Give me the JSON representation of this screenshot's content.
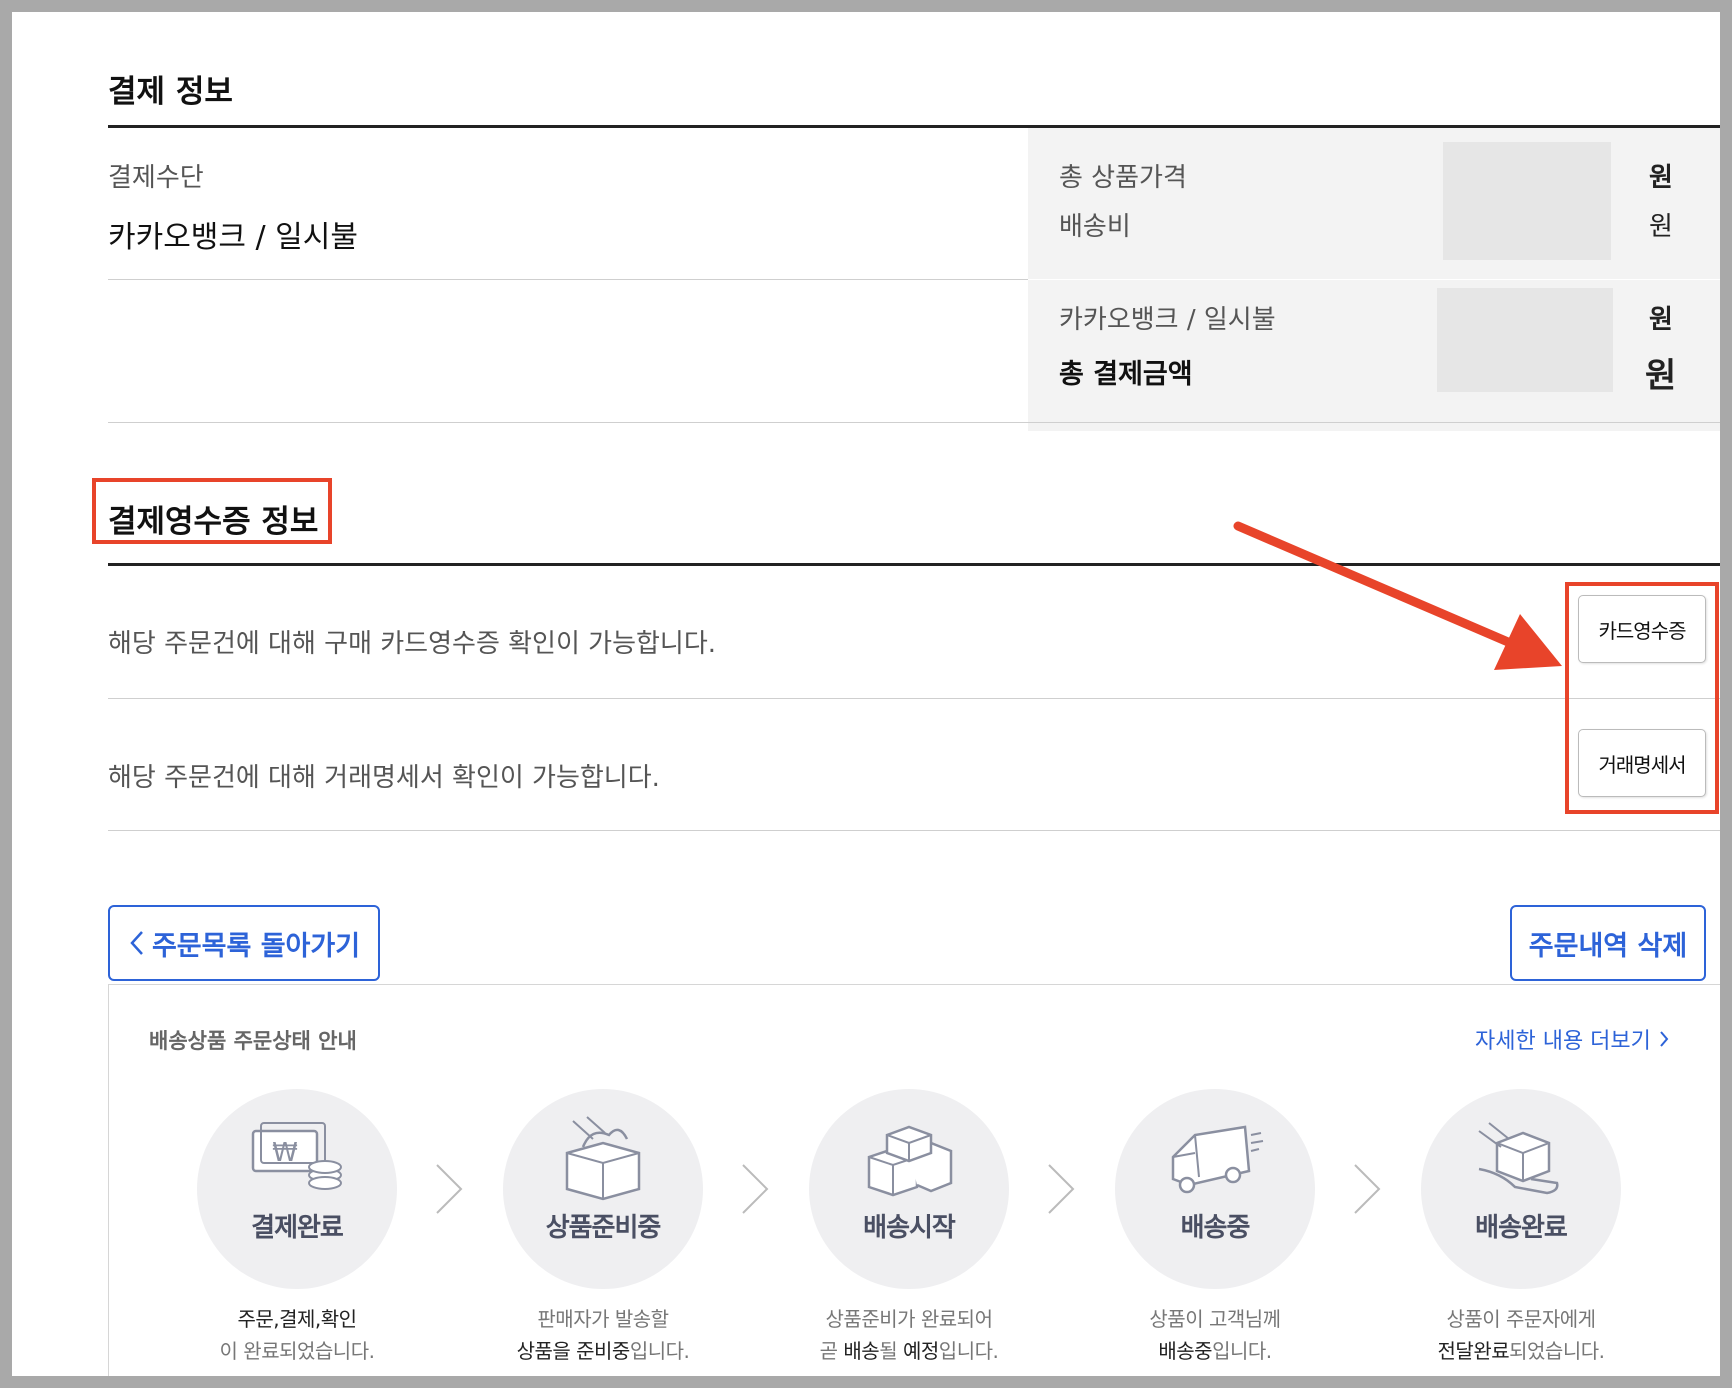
{
  "payment_info": {
    "title": "결제 정보",
    "method_label": "결제수단",
    "method_value": "카카오뱅크 / 일시불",
    "total_product_label": "총 상품가격",
    "shipping_label": "배송비",
    "won": "원",
    "pay_method_label": "카카오뱅크 / 일시불",
    "total_payment_label": "총 결제금액"
  },
  "receipt_info": {
    "title": "결제영수증 정보",
    "card_receipt_text": "해당 주문건에 대해 구매 카드영수증 확인이 가능합니다.",
    "card_receipt_button": "카드영수증",
    "statement_text": "해당 주문건에 대해 거래명세서 확인이 가능합니다.",
    "statement_button": "거래명세서"
  },
  "actions": {
    "back_button": "주문목록 돌아가기",
    "delete_button": "주문내역 삭제"
  },
  "status_guide": {
    "title": "배송상품 주문상태 안내",
    "more_link": "자세한 내용 더보기",
    "steps": [
      {
        "label": "결제완료",
        "icon": "payment-money-icon",
        "line1": "주문,결제,확인",
        "line2": "이 완료되었습니다."
      },
      {
        "label": "상품준비중",
        "icon": "product-box-prep-icon",
        "line1": "판매자가 발송할",
        "line2a": "상품을 준비중",
        "line2b": "입니다."
      },
      {
        "label": "배송시작",
        "icon": "boxes-icon",
        "line1": "상품준비가 완료되어",
        "line2a": "곧 ",
        "line2b": "배송",
        "line2c": "될 ",
        "line2d": "예정",
        "line2e": "입니다."
      },
      {
        "label": "배송중",
        "icon": "delivery-truck-icon",
        "line1": "상품이 고객님께",
        "line2a": "배송중",
        "line2b": "입니다."
      },
      {
        "label": "배송완료",
        "icon": "delivered-hand-icon",
        "line1": "상품이 주문자에게",
        "line2a": "전달완료",
        "line2b": "되었습니다."
      }
    ]
  },
  "colors": {
    "accent_blue": "#2d63d8",
    "annotation_red": "#e8442a"
  }
}
